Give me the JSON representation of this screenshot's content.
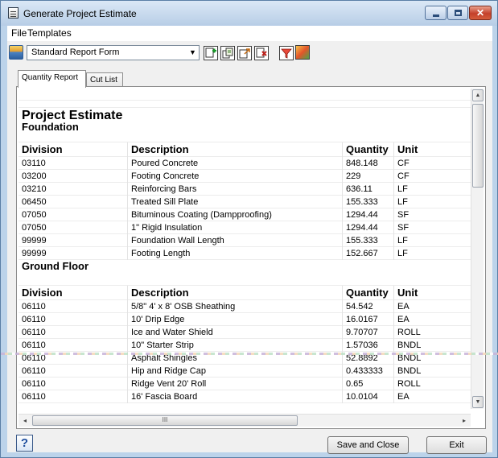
{
  "window": {
    "title": "Generate Project Estimate"
  },
  "menu": [
    "File",
    "Templates"
  ],
  "toolbar": {
    "report_form": "Standard Report Form",
    "icons": [
      "report-icon",
      "add-icon",
      "copy-icon",
      "export-icon",
      "delete-icon",
      "filter-icon",
      "color-icon"
    ]
  },
  "tabs": [
    "Quantity Report",
    "Cut List"
  ],
  "report": {
    "title": "Project Estimate",
    "columns": [
      "Division",
      "Description",
      "Quantity",
      "Unit"
    ],
    "sections": [
      {
        "name": "Foundation",
        "rows": [
          [
            "03110",
            "Poured Concrete",
            "848.148",
            "CF"
          ],
          [
            "03200",
            "Footing Concrete",
            "229",
            "CF"
          ],
          [
            "03210",
            "Reinforcing Bars",
            "636.11",
            "LF"
          ],
          [
            "06450",
            "Treated Sill Plate",
            "155.333",
            "LF"
          ],
          [
            "07050",
            "Bituminous Coating (Dampproofing)",
            "1294.44",
            "SF"
          ],
          [
            "07050",
            "1\" Rigid Insulation",
            "1294.44",
            "SF"
          ],
          [
            "99999",
            "Foundation Wall Length",
            "155.333",
            "LF"
          ],
          [
            "99999",
            "Footing Length",
            "152.667",
            "LF"
          ]
        ]
      },
      {
        "name": "Ground Floor",
        "rows": [
          [
            "06110",
            "5/8\" 4' x 8' OSB Sheathing",
            "54.542",
            "EA"
          ],
          [
            "06110",
            "10' Drip Edge",
            "16.0167",
            "EA"
          ],
          [
            "06110",
            "Ice and Water Shield",
            "9.70707",
            "ROLL"
          ],
          [
            "06110",
            "10\" Starter Strip",
            "1.57036",
            "BNDL"
          ],
          [
            "06110",
            "Asphalt Shingles",
            "52.8892",
            "BNDL"
          ],
          [
            "06110",
            "Hip and Ridge Cap",
            "0.433333",
            "BNDL"
          ],
          [
            "06110",
            "Ridge Vent 20' Roll",
            "0.65",
            "ROLL"
          ],
          [
            "06110",
            "16' Fascia Board",
            "10.0104",
            "EA"
          ]
        ]
      }
    ]
  },
  "scroll": {
    "hthumb_label": "III"
  },
  "buttons": {
    "help": "?",
    "save_close": "Save and Close",
    "exit": "Exit"
  }
}
